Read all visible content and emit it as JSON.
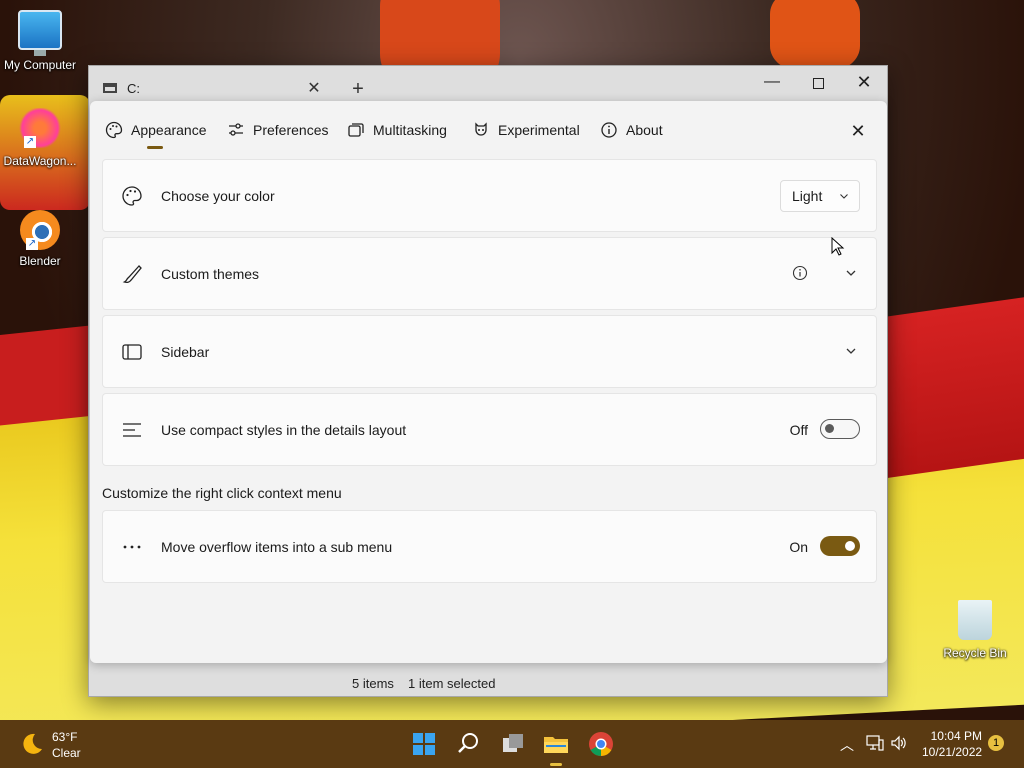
{
  "desktop": {
    "icons": [
      {
        "label": "My Computer"
      },
      {
        "label": "DataWagon..."
      },
      {
        "label": "Blender"
      },
      {
        "label": "Recycle Bin"
      }
    ]
  },
  "window": {
    "tab_title": "C:",
    "tab_close_glyph": "✕",
    "new_tab_glyph": "+",
    "minimize_glyph": "—",
    "close_glyph": "✕"
  },
  "settings": {
    "nav": [
      {
        "label": "Appearance",
        "icon": "palette-icon",
        "selected": true
      },
      {
        "label": "Preferences",
        "icon": "sliders-icon"
      },
      {
        "label": "Multitasking",
        "icon": "windows-icon"
      },
      {
        "label": "Experimental",
        "icon": "flask-icon"
      },
      {
        "label": "About",
        "icon": "info-icon"
      }
    ],
    "close_glyph": "✕",
    "cards": {
      "color": {
        "label": "Choose your color",
        "value": "Light"
      },
      "themes": {
        "label": "Custom themes"
      },
      "sidebar": {
        "label": "Sidebar"
      },
      "compact": {
        "label": "Use compact styles in the details layout",
        "state_text": "Off",
        "enabled": false
      }
    },
    "context_section": {
      "heading": "Customize the right click context menu",
      "overflow": {
        "label": "Move overflow items into a sub menu",
        "state_text": "On",
        "enabled": true
      }
    },
    "accent_color": "#7a5a12"
  },
  "status_bar": {
    "items_count": "5 items",
    "selection": "1 item selected"
  },
  "taskbar": {
    "weather": {
      "temp": "63°F",
      "condition": "Clear"
    },
    "apps": [
      "start-icon",
      "search-icon",
      "task-view-icon",
      "file-explorer-icon",
      "chrome-icon"
    ],
    "tray": {
      "chevron_glyph": "︿"
    },
    "clock": {
      "time": "10:04 PM",
      "date": "10/21/2022"
    },
    "notification_count": "1"
  }
}
